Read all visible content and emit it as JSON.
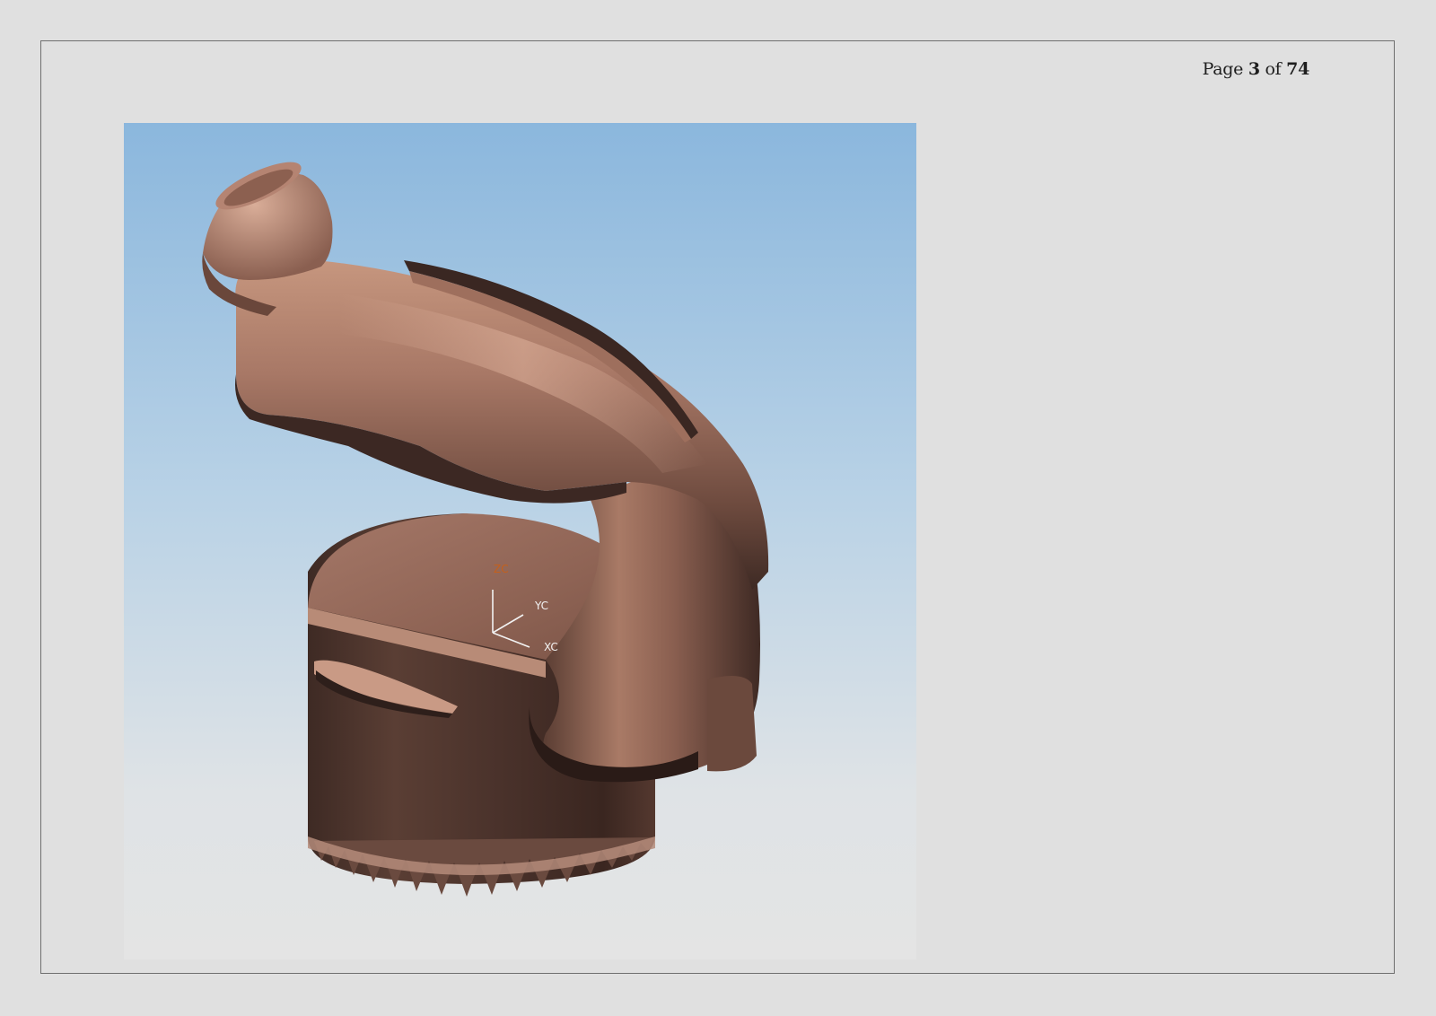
{
  "header": {
    "page_prefix": "Page",
    "current_page": "3",
    "page_of": "of",
    "total_pages": "74"
  },
  "figure": {
    "axis_labels": {
      "z": "ZC",
      "y": "YC",
      "x": "XC"
    },
    "colors": {
      "sky_top": "#8bb7dd",
      "sky_bottom": "#e4e4e4",
      "model_bronze": "#9a6c5c",
      "model_dark": "#3a2722",
      "model_highlight": "#d3a592",
      "z_axis_label": "#c5601b"
    }
  }
}
